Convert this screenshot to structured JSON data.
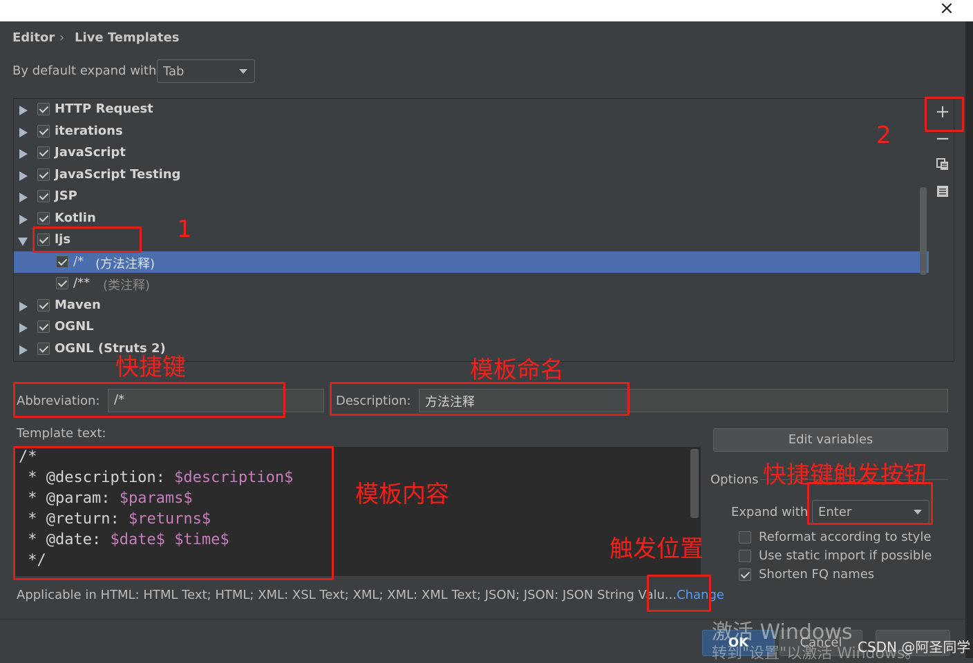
{
  "window": {
    "close_glyph": "×"
  },
  "breadcrumb": {
    "section": "Editor",
    "page": "Live Templates",
    "separator": "›"
  },
  "default_expand": {
    "label": "By default expand with",
    "value": "Tab"
  },
  "tree": {
    "rows": [
      {
        "label": "HTTP Request",
        "expanded": false
      },
      {
        "label": "iterations",
        "expanded": false
      },
      {
        "label": "JavaScript",
        "expanded": false
      },
      {
        "label": "JavaScript Testing",
        "expanded": false
      },
      {
        "label": "JSP",
        "expanded": false
      },
      {
        "label": "Kotlin",
        "expanded": false
      },
      {
        "label": "ljs",
        "expanded": true
      },
      {
        "label": "/*",
        "desc": "(方法注释)",
        "child": true,
        "selected": true
      },
      {
        "label": "/**",
        "desc": "(类注释)",
        "child": true
      },
      {
        "label": "Maven",
        "expanded": false
      },
      {
        "label": "OGNL",
        "expanded": false
      },
      {
        "label": "OGNL (Struts 2)",
        "expanded": false
      }
    ]
  },
  "toolbar": {
    "add": "+",
    "remove": "−"
  },
  "abbreviation": {
    "label": "Abbreviation:",
    "value": "/*"
  },
  "description": {
    "label": "Description:",
    "value": "方法注释"
  },
  "template_text": {
    "label": "Template text:",
    "lines": [
      [
        {
          "t": "/*"
        }
      ],
      [
        {
          "t": " * @description: "
        },
        {
          "t": "$description$",
          "v": true
        }
      ],
      [
        {
          "t": " * @param: "
        },
        {
          "t": "$params$",
          "v": true
        }
      ],
      [
        {
          "t": " * @return: "
        },
        {
          "t": "$returns$",
          "v": true
        }
      ],
      [
        {
          "t": " * @date: "
        },
        {
          "t": "$date$",
          "v": true
        },
        {
          "t": " "
        },
        {
          "t": "$time$",
          "v": true
        }
      ],
      [
        {
          "t": " */"
        }
      ]
    ]
  },
  "edit_variables": "Edit variables",
  "options": {
    "title": "Options",
    "expand_label": "Expand with",
    "expand_value": "Enter",
    "checkboxes": [
      {
        "label": "Reformat according to style",
        "checked": false
      },
      {
        "label": "Use static import if possible",
        "checked": false
      },
      {
        "label": "Shorten FQ names",
        "checked": true
      }
    ]
  },
  "applicable": {
    "text": "Applicable in HTML: HTML Text; HTML; XML: XSL Text; XML; XML: XML Text; JSON; JSON: JSON String Valu...",
    "link": "Change"
  },
  "annotations": {
    "n1": "1",
    "n2": "2",
    "shortcut": "快捷键",
    "template_name": "模板命名",
    "template_content": "模板内容",
    "trigger_key": "快捷键触发按钮",
    "trigger_location": "触发位置"
  },
  "footer": {
    "ok": "OK",
    "cancel": "Cancel",
    "watermark_line1": "激活 Windows",
    "watermark_line2": "转到\"设置\"以激活 Windows。",
    "credit": "CSDN @阿圣同学"
  }
}
